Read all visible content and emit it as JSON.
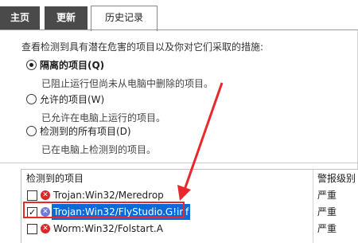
{
  "tabs": [
    {
      "label": "主页",
      "active": false
    },
    {
      "label": "更新",
      "active": false
    },
    {
      "label": "历史记录",
      "active": true
    }
  ],
  "description": "查看检测到具有潜在危害的项目以及你对它们采取的措施:",
  "filters": [
    {
      "label": "隔离的项目(Q)",
      "sub": "已阻止运行但尚未从电脑中删除的项目。",
      "selected": true
    },
    {
      "label": "允许的项目(W)",
      "sub": "已允许在电脑上运行的项目。",
      "selected": false
    },
    {
      "label": "检测到的所有项目(D)",
      "sub": "已在电脑上检测到的项目。",
      "selected": false
    }
  ],
  "table": {
    "columns": [
      "检测到的项目",
      "警报级别"
    ],
    "rows": [
      {
        "name": "Trojan:Win32/Meredrop",
        "level": "严重",
        "checked": false,
        "selected": false
      },
      {
        "name": "Trojan:Win32/FlyStudio.G!inf",
        "level": "严重",
        "checked": true,
        "selected": true
      },
      {
        "name": "Worm:Win32/Folstart.A",
        "level": "严重",
        "checked": false,
        "selected": false
      }
    ]
  },
  "colors": {
    "accent": "#0a6ad6",
    "threat": "#d9282b",
    "annotation": "#e8282c",
    "tab_dark": "#4a4a4a"
  },
  "icons": {
    "threat": "threat-x-icon"
  }
}
